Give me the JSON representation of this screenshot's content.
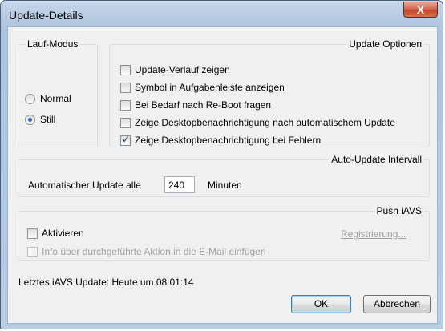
{
  "window": {
    "title": "Update-Details",
    "close_label": "X"
  },
  "lauf_modus": {
    "legend": "Lauf-Modus",
    "options": [
      {
        "label": "Normal",
        "selected": false
      },
      {
        "label": "Still",
        "selected": true
      }
    ]
  },
  "update_optionen": {
    "legend": "Update Optionen",
    "options": [
      {
        "label": "Update-Verlauf zeigen",
        "checked": false
      },
      {
        "label": "Symbol in Aufgabenleiste anzeigen",
        "checked": false
      },
      {
        "label": "Bei Bedarf nach Re-Boot fragen",
        "checked": false
      },
      {
        "label": "Zeige Desktopbenachrichtigung nach automatischem Update",
        "checked": false
      },
      {
        "label": "Zeige Desktopbenachrichtigung bei Fehlern",
        "checked": true
      }
    ]
  },
  "auto_update": {
    "legend": "Auto-Update Intervall",
    "label_before": "Automatischer Update alle",
    "value": "240",
    "label_after": "Minuten"
  },
  "push_iavs": {
    "legend": "Push iAVS",
    "activate_label": "Aktivieren",
    "activate_checked": false,
    "info_label": "Info über durchgeführte Aktion in die E-Mail einfügen",
    "info_checked": false,
    "info_enabled": false,
    "register_link": "Registrierung..."
  },
  "status": {
    "last_update": "Letztes iAVS Update: Heute um 08:01:14"
  },
  "buttons": {
    "ok": "OK",
    "cancel": "Abbrechen"
  }
}
